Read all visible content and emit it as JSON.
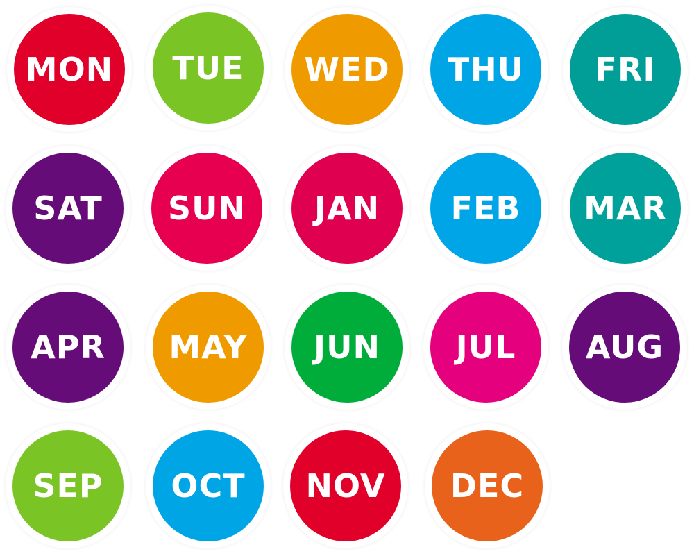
{
  "badges": [
    {
      "label": "MON",
      "color": "#e1002a"
    },
    {
      "label": "TUE",
      "color": "#7bc426"
    },
    {
      "label": "WED",
      "color": "#ef9b00"
    },
    {
      "label": "THU",
      "color": "#00a5e6"
    },
    {
      "label": "FRI",
      "color": "#009e96"
    },
    {
      "label": "SAT",
      "color": "#650c79"
    },
    {
      "label": "SUN",
      "color": "#e6004f"
    },
    {
      "label": "JAN",
      "color": "#e00050"
    },
    {
      "label": "FEB",
      "color": "#00a5e7"
    },
    {
      "label": "MAR",
      "color": "#00a19a"
    },
    {
      "label": "APR",
      "color": "#650c79"
    },
    {
      "label": "MAY",
      "color": "#ef9b00"
    },
    {
      "label": "JUN",
      "color": "#00ad3a"
    },
    {
      "label": "JUL",
      "color": "#e5007e"
    },
    {
      "label": "AUG",
      "color": "#650c79"
    },
    {
      "label": "SEP",
      "color": "#7bc426"
    },
    {
      "label": "OCT",
      "color": "#00a5e6"
    },
    {
      "label": "NOV",
      "color": "#e1002a"
    },
    {
      "label": "DEC",
      "color": "#e8621c"
    }
  ]
}
